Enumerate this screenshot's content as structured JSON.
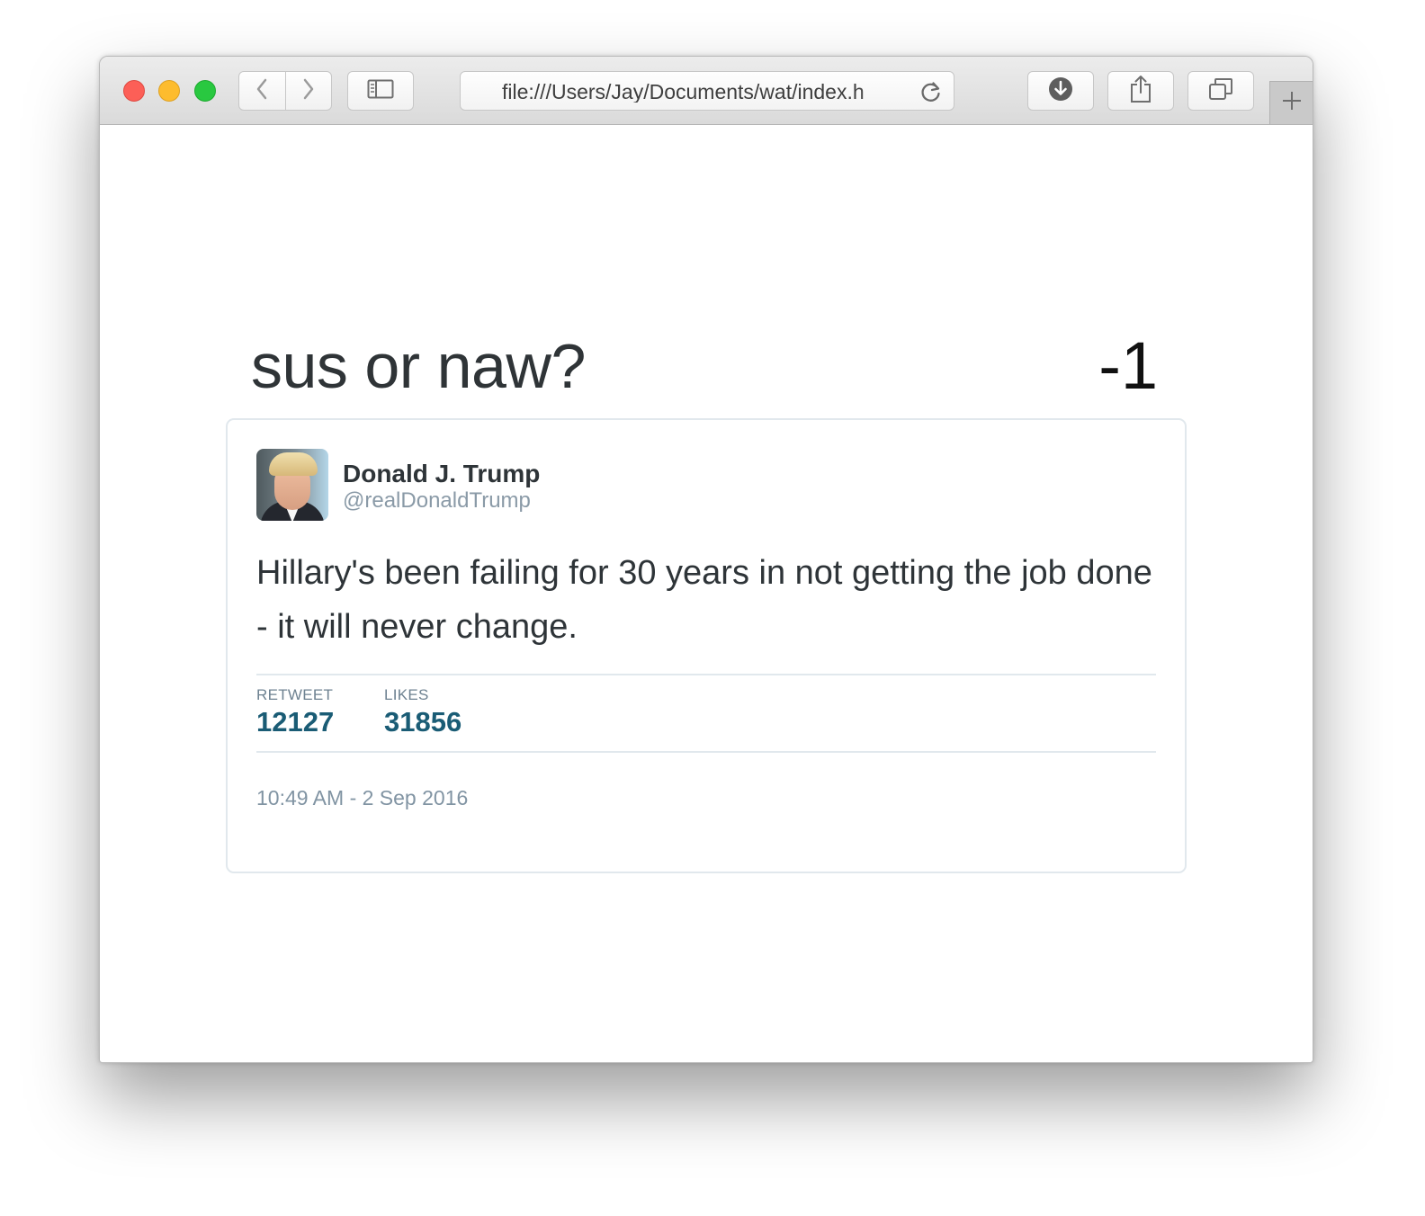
{
  "browser": {
    "url": "file:///Users/Jay/Documents/wat/index.h",
    "icons": {
      "back": "chevron-left-icon",
      "forward": "chevron-right-icon",
      "sidebar": "sidebar-icon",
      "reload": "reload-icon",
      "downloads": "download-icon",
      "share": "share-icon",
      "tabs": "tabs-icon",
      "new_tab": "plus-icon"
    },
    "traffic_colors": {
      "close": "#fc5f57",
      "minimize": "#fdbc2e",
      "maximize": "#29c840"
    }
  },
  "page": {
    "heading": "sus or naw?",
    "score": "-1"
  },
  "tweet": {
    "author": {
      "name": "Donald J. Trump",
      "handle": "@realDonaldTrump"
    },
    "text": "Hillary's been failing for 30 years in not getting the job done - it will never change.",
    "stats": {
      "retweets_label": "RETWEET",
      "retweets_value": "12127",
      "likes_label": "LIKES",
      "likes_value": "31856"
    },
    "timestamp": "10:49 AM - 2 Sep 2016"
  },
  "colors": {
    "stat_value": "#1a5c75",
    "muted_text": "#8194a3",
    "card_border": "#e1e8ed"
  }
}
